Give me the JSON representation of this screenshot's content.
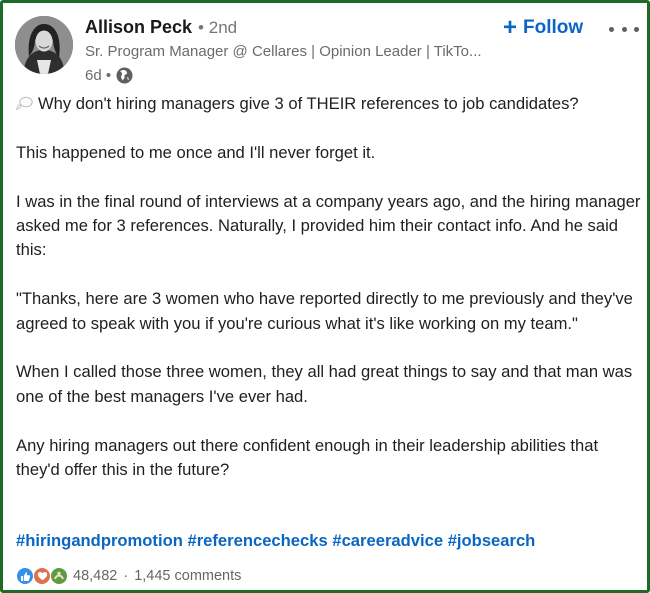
{
  "author": {
    "name": "Allison Peck",
    "degree": "2nd",
    "headline": "Sr. Program Manager @ Cellares | Opinion Leader | TikTo...",
    "time": "6d",
    "visibility_icon": "globe-icon"
  },
  "actions": {
    "follow_label": "Follow",
    "follow_plus": "+",
    "more_icon": "ellipsis-icon"
  },
  "post": {
    "opening": "Why don't hiring managers give 3 of THEIR references to job candidates?",
    "p2": "This happened to me once and I'll never forget it.",
    "p3": "I was in the final round of interviews at a company years ago, and the hiring manager asked me for 3 references. Naturally, I provided him their contact info. And he said this:",
    "p4": "\"Thanks, here are 3 women who have reported directly to me previously and they've agreed to speak with you if you're curious what it's like working on my team.\"",
    "p5": "When I called those three women, they all had great things to say and that man was one of the best managers I've ever had.",
    "p6": "Any hiring managers out there confident enough in their leadership abilities that they'd offer this in the future?"
  },
  "hashtags": [
    "#hiringandpromotion",
    "#referencechecks",
    "#careeradvice",
    "#jobsearch"
  ],
  "social": {
    "reaction_icons": [
      "like-icon",
      "love-icon",
      "support-icon"
    ],
    "reaction_count": "48,482",
    "separator": "·",
    "comments": "1,445 comments"
  },
  "colors": {
    "frame_border": "#1e6b28",
    "link_blue": "#0a66c2",
    "like": "#378fe9",
    "love": "#df704d",
    "support": "#5f9b41"
  }
}
